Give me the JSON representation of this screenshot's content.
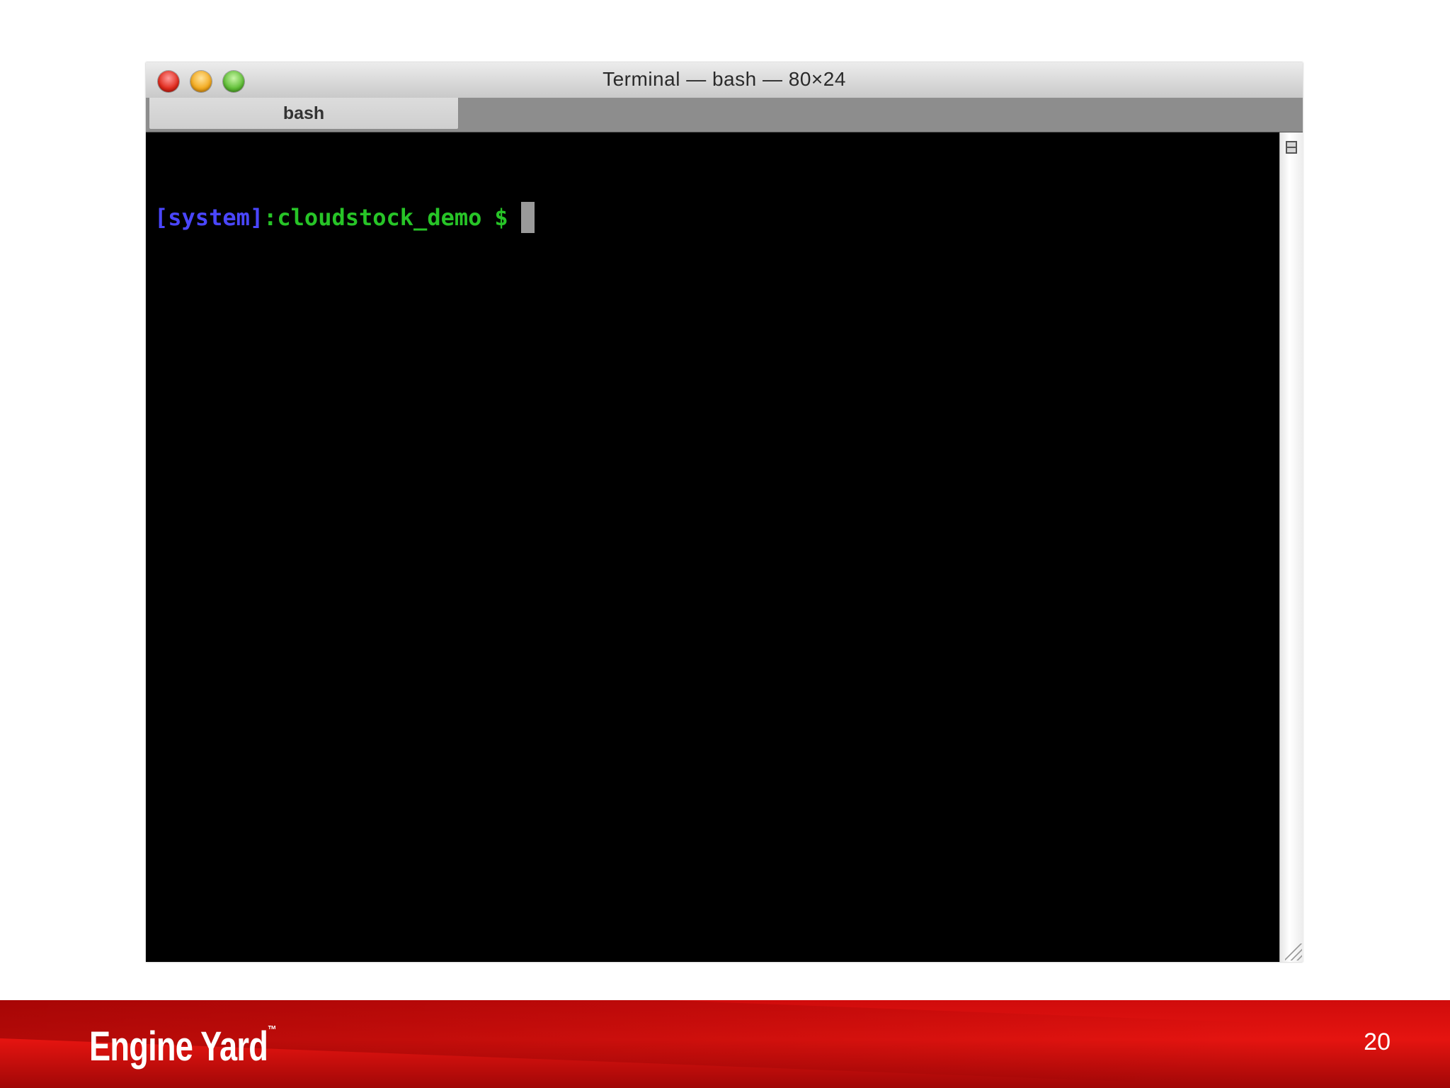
{
  "window": {
    "title": "Terminal — bash — 80×24",
    "tabs": [
      {
        "label": "bash"
      }
    ]
  },
  "terminal": {
    "prompt_user": "[system]",
    "prompt_path": ":cloudstock_demo",
    "prompt_symbol": "$"
  },
  "footer": {
    "logo_text": "Engine Yard",
    "logo_mark": "™",
    "page_number": "20"
  },
  "colors": {
    "prompt_user": "#4a46ff",
    "prompt_path": "#27c427",
    "footer_red": "#e51410",
    "terminal_bg": "#000000"
  },
  "icons": {
    "close": "close-window-icon",
    "minimize": "minimize-window-icon",
    "zoom": "zoom-window-icon",
    "split": "split-pane-icon",
    "resize": "resize-grip-icon"
  }
}
